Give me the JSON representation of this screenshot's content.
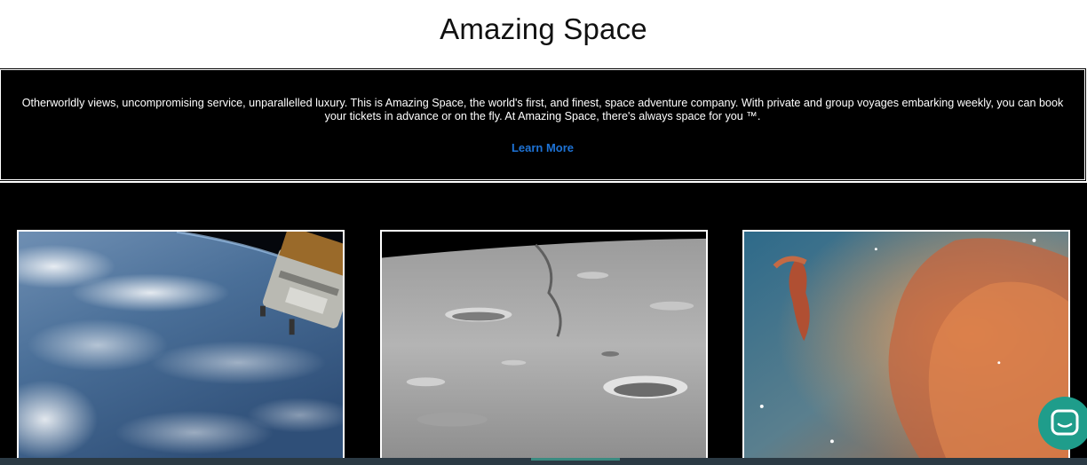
{
  "header": {
    "title": "Amazing Space"
  },
  "hero": {
    "description": "Otherworldly views, uncompromising service, unparallelled luxury. This is Amazing Space, the world's first, and finest, space adventure company. With private and group voyages embarking weekly, you can book your tickets in advance or on the fly. At Amazing Space, there's always space for you ™.",
    "link_label": "Learn More"
  },
  "gallery": {
    "images": [
      {
        "subject": "earth-orbit-space-station"
      },
      {
        "subject": "lunar-surface-craters"
      },
      {
        "subject": "nebula-pillars"
      }
    ]
  },
  "chat": {
    "icon": "chat-bubble-icon"
  },
  "colors": {
    "link": "#1e73d6",
    "chat_bg": "#1f9d8b",
    "hero_bg": "#000000"
  }
}
